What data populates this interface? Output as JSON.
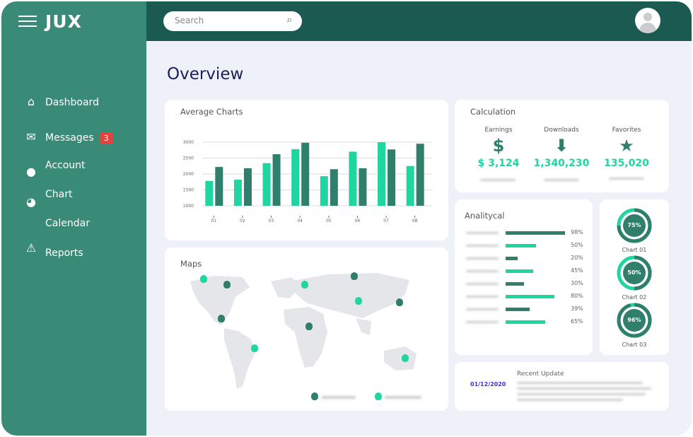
{
  "app": {
    "logo": "JUX"
  },
  "header": {
    "search_placeholder": "Search"
  },
  "sidebar": {
    "items": [
      {
        "label": "Dashboard",
        "icon": "home-icon"
      },
      {
        "label": "Messages",
        "icon": "envelope-icon",
        "badge": "3"
      },
      {
        "label": "Account",
        "icon": "user-icon"
      },
      {
        "label": "Chart",
        "icon": "pie-chart-icon"
      },
      {
        "label": "Calendar",
        "icon": "calendar-icon"
      },
      {
        "label": "Reports",
        "icon": "warning-icon"
      }
    ]
  },
  "main": {
    "title": "Overview"
  },
  "colors": {
    "accent_light": "#1fd6a0",
    "accent_dark": "#2f7f6c",
    "sidebar": "#3a8a78",
    "header": "#1b5a50",
    "badge": "#e8413b"
  },
  "average_charts": {
    "title": "Average Charts"
  },
  "chart_data": {
    "type": "bar",
    "categories": [
      "01",
      "02",
      "03",
      "04",
      "05",
      "06",
      "07",
      "08"
    ],
    "series": [
      {
        "values": [
          1780,
          1820,
          2340,
          2780,
          1930,
          2700,
          3000,
          2250
        ],
        "color": "#1fd6a0"
      },
      {
        "values": [
          2220,
          2180,
          2620,
          2980,
          2150,
          2180,
          2770,
          2950
        ],
        "color": "#2f7f6c"
      }
    ],
    "yticks": [
      1000,
      1500,
      2000,
      2500,
      3000
    ],
    "ylim": [
      1000,
      3000
    ],
    "grid": true
  },
  "maps": {
    "title": "Maps"
  },
  "calculation": {
    "title": "Calculation",
    "items": [
      {
        "label": "Earnings",
        "icon": "dollar-icon",
        "value": "$ 3,124"
      },
      {
        "label": "Downloads",
        "icon": "download-arrow-icon",
        "value": "1,340,230"
      },
      {
        "label": "Favorites",
        "icon": "star-icon",
        "value": "135,020"
      }
    ]
  },
  "analytical": {
    "title": "Analitycal",
    "rows": [
      {
        "pct": "98%",
        "value": 98
      },
      {
        "pct": "50%",
        "value": 50
      },
      {
        "pct": "20%",
        "value": 20
      },
      {
        "pct": "45%",
        "value": 45
      },
      {
        "pct": "30%",
        "value": 30
      },
      {
        "pct": "80%",
        "value": 80
      },
      {
        "pct": "39%",
        "value": 39
      },
      {
        "pct": "65%",
        "value": 65
      }
    ]
  },
  "donuts": [
    {
      "label": "Chart 01",
      "pct": "75%",
      "value": 75
    },
    {
      "label": "Chart 02",
      "pct": "50%",
      "value": 50
    },
    {
      "label": "Chart 03",
      "pct": "96%",
      "value": 96
    }
  ],
  "recent": {
    "title": "Recent Update",
    "date": "01/12/2020"
  }
}
